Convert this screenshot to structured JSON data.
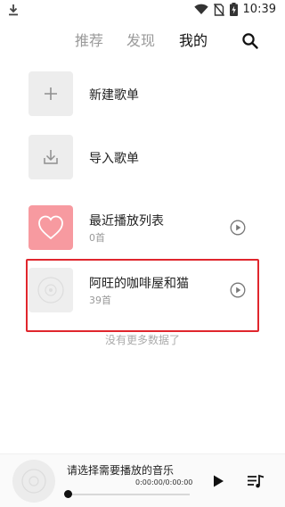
{
  "status_bar": {
    "time": "10:39",
    "icons": [
      "download-icon",
      "wifi-icon",
      "no-sim-icon",
      "battery-charging-icon"
    ]
  },
  "tabs": [
    {
      "label": "推荐",
      "active": false
    },
    {
      "label": "发现",
      "active": false
    },
    {
      "label": "我的",
      "active": true
    }
  ],
  "lists": {
    "new_playlist": {
      "title": "新建歌单",
      "icon": "plus-icon"
    },
    "import_playlist": {
      "title": "导入歌单",
      "icon": "import-icon"
    },
    "recent": {
      "title": "最近播放列表",
      "count": "0首",
      "icon": "heart-icon"
    },
    "playlist": {
      "title": "阿旺的咖啡屋和猫",
      "count": "39首",
      "icon": "disc-icon"
    }
  },
  "no_more_text": "没有更多数据了",
  "player": {
    "title": "请选择需要播放的音乐",
    "time": "0:00:00/0:00:00",
    "progress": 0
  },
  "colors": {
    "accent_pink": "#f79aa0",
    "highlight_red": "#e0262d",
    "tab_inactive": "#9a9a9a"
  }
}
